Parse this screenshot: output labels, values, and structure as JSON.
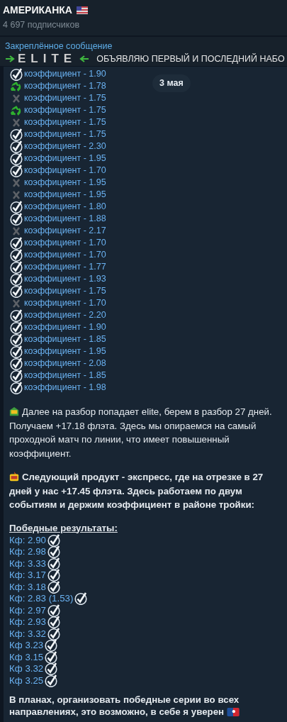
{
  "header": {
    "title": "АМЕРИКАНКА",
    "subtitle": "4 697 подписчиков"
  },
  "pinned": {
    "label": "Закреплённое сообщение",
    "logo": "ELITE",
    "text": "ОБЪЯВЛЯЮ ПЕРВЫЙ И ПОСЛЕДНИЙ НАБО"
  },
  "date_badge": "3 мая",
  "bets": [
    {
      "kind": "win",
      "text": "коэффициент - 1.90"
    },
    {
      "kind": "refund",
      "text": "коэффициент - 1.78"
    },
    {
      "kind": "loss",
      "text": "коэффициент - 1.75"
    },
    {
      "kind": "refund",
      "text": "коэффициент - 1.75"
    },
    {
      "kind": "loss",
      "text": "коэффициент - 1.75"
    },
    {
      "kind": "win",
      "text": "коэффициент - 1.75"
    },
    {
      "kind": "win",
      "text": "коэффициент - 2.30"
    },
    {
      "kind": "win",
      "text": "коэффициент - 1.95"
    },
    {
      "kind": "win",
      "text": "коэффициент - 1.70"
    },
    {
      "kind": "loss",
      "text": "коэффициент - 1.95"
    },
    {
      "kind": "loss",
      "text": "коэффициент - 1.95"
    },
    {
      "kind": "win",
      "text": "коэффициент - 1.80"
    },
    {
      "kind": "win",
      "text": "коэффициент - 1.88"
    },
    {
      "kind": "loss",
      "text": "коэффициент - 2.17"
    },
    {
      "kind": "win",
      "text": "коэффициент - 1.70"
    },
    {
      "kind": "win",
      "text": "коэффициент - 1.70"
    },
    {
      "kind": "win",
      "text": "коэффициент - 1.77"
    },
    {
      "kind": "win",
      "text": "коэффициент - 1.93"
    },
    {
      "kind": "win",
      "text": "коэффициент - 1.75"
    },
    {
      "kind": "loss",
      "text": "коэффициент - 1.70"
    },
    {
      "kind": "win",
      "text": "коэффициент - 2.20"
    },
    {
      "kind": "win",
      "text": "коэффициент - 1.90"
    },
    {
      "kind": "win",
      "text": "коэффициент - 1.85"
    },
    {
      "kind": "win",
      "text": "коэффициент - 1.95"
    },
    {
      "kind": "win",
      "text": "коэффициент - 2.08"
    },
    {
      "kind": "win",
      "text": "коэффициент - 1.85"
    },
    {
      "kind": "win",
      "text": "коэффициент - 1.98"
    }
  ],
  "paragraph_1": "Далее на разбор попадает elite, берем в разбор 27 дней. Получаем +17.18 флэта. Здесь мы опираемся на самый проходной матч по линии, что имеет повышенный коэффициент.",
  "paragraph_2": "Следующий продукт - экспресс, где на отрезке в 27 дней у нас +17.45 флэта. Здесь работаем по двум событиям и держим коэффициент в районе тройки:",
  "results_heading": "Победные результаты:",
  "results": [
    "Кф: 2.90",
    "Кф: 2.98",
    "Кф: 3.33",
    "Кф: 3.17",
    "Кф: 3.18",
    "Кф: 2.83 (1.53)",
    "Кф: 2.97",
    "Кф: 2.93",
    "Кф: 3.32",
    "Кф 3.23",
    "Кф 3.15",
    "Кф 3.32",
    "Кф 3.25"
  ],
  "paragraph_3": "В планах, организовать победные серии во всех направлениях, это возможно, в себе я уверен"
}
